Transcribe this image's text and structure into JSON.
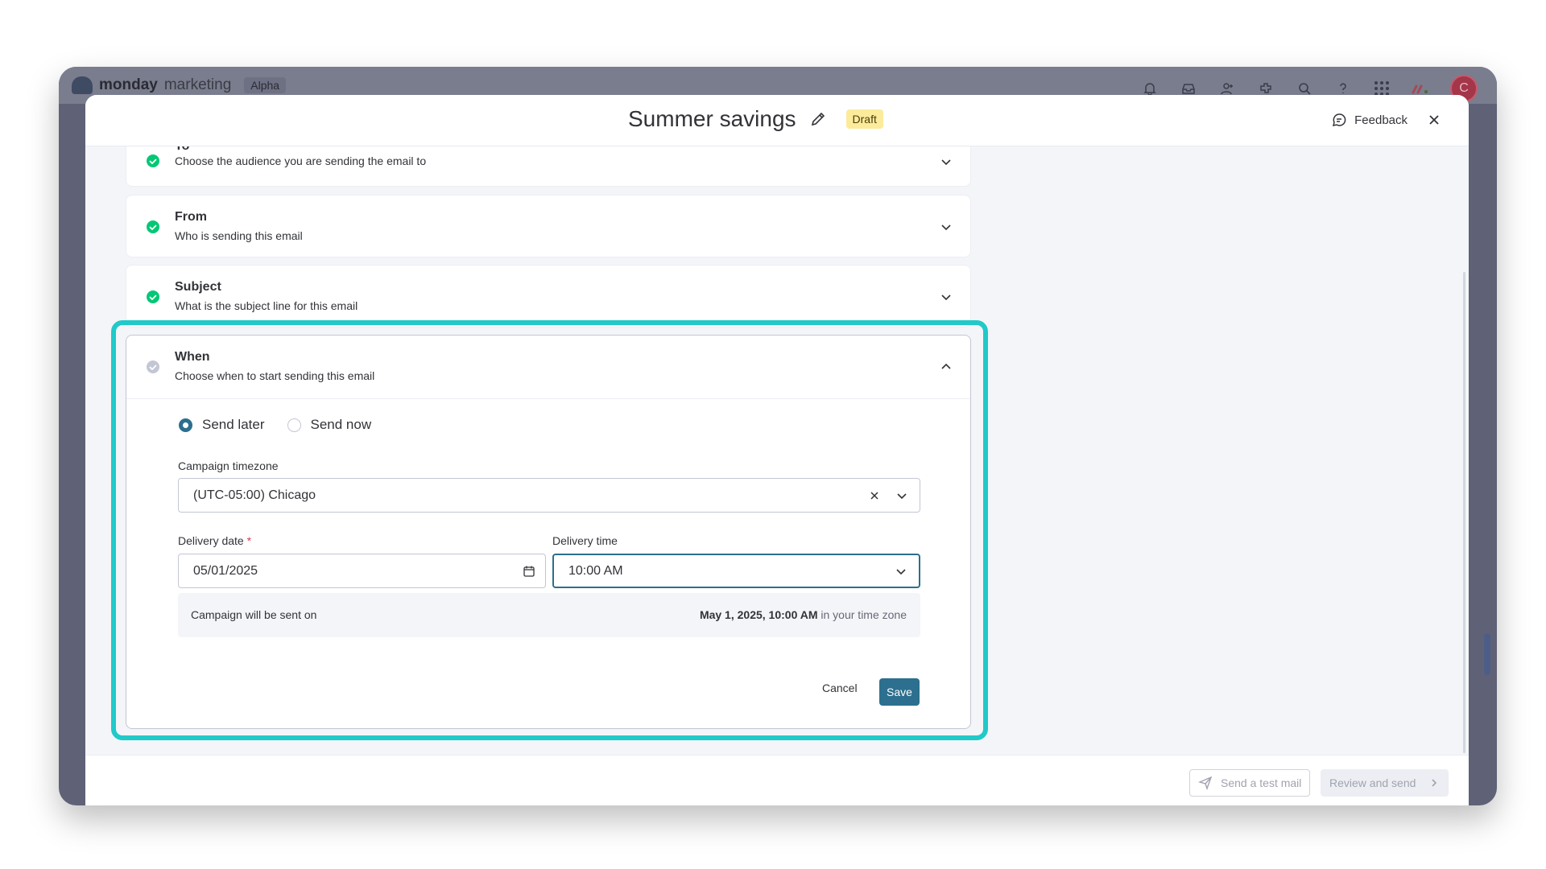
{
  "app": {
    "brand_name": "monday",
    "brand_suffix": "marketing",
    "brand_tag": "Alpha",
    "avatar_initial": "C",
    "top_icons": [
      "bell-icon",
      "inbox-icon",
      "invite-user-icon",
      "apps-icon",
      "search-icon",
      "help-icon",
      "grid-menu-icon",
      "monday-logo-icon"
    ]
  },
  "modal": {
    "title": "Summer savings",
    "status_badge": "Draft",
    "feedback_label": "Feedback"
  },
  "sections": {
    "to": {
      "title": "To",
      "subtitle": "Choose the audience you are sending the email to"
    },
    "from": {
      "title": "From",
      "subtitle": "Who is sending this email"
    },
    "subject": {
      "title": "Subject",
      "subtitle": "What is the subject line for this email"
    },
    "when": {
      "title": "When",
      "subtitle": "Choose when to start sending this email"
    }
  },
  "when_form": {
    "send_later_label": "Send later",
    "send_now_label": "Send now",
    "selected_option": "Send later",
    "timezone_label": "Campaign timezone",
    "timezone_value": "(UTC-05:00) Chicago",
    "delivery_date_label": "Delivery date",
    "required_mark": "*",
    "delivery_date_value": "05/01/2025",
    "delivery_time_label": "Delivery time",
    "delivery_time_value": "10:00 AM",
    "summary_prefix": "Campaign will be sent on",
    "summary_datetime": "May 1, 2025, 10:00 AM",
    "summary_suffix": "in your time zone",
    "cancel_label": "Cancel",
    "save_label": "Save"
  },
  "footer": {
    "test_mail_label": "Send a test mail",
    "review_label": "Review and send"
  },
  "colors": {
    "accent": "#2c6f8e",
    "highlight": "#21c9c9",
    "success": "#00c875",
    "draft_badge_bg": "#fdeb9c"
  }
}
